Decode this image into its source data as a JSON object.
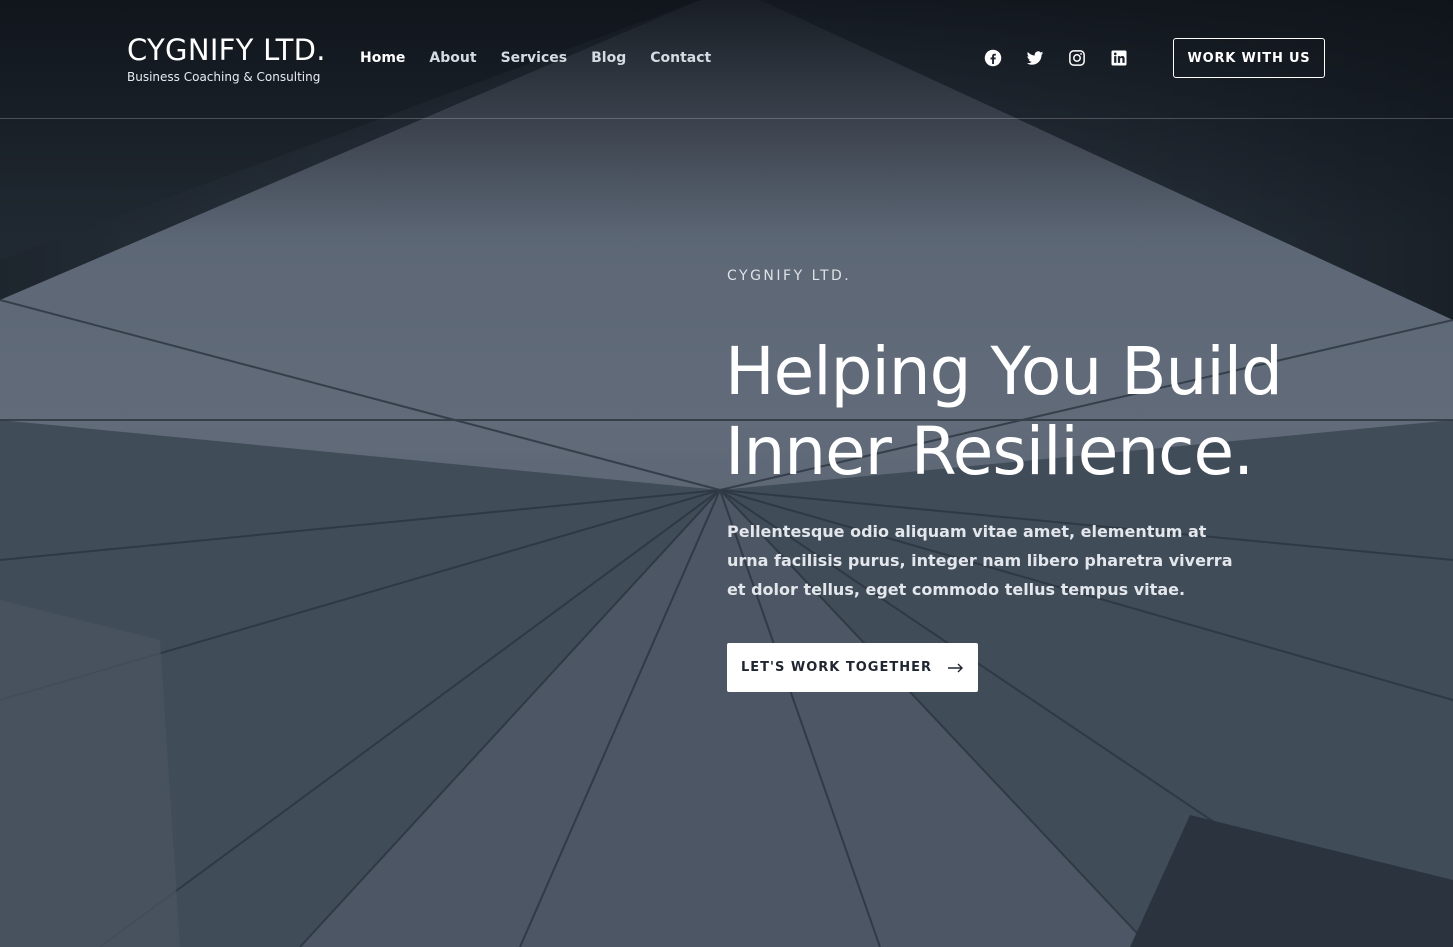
{
  "colors": {
    "overlay": "#2f3845",
    "text": "#ffffff",
    "button_bg": "#ffffff",
    "button_text": "#1f2630"
  },
  "header": {
    "brand_name": "CYGNIFY LTD.",
    "brand_tagline": "Business Coaching & Consulting",
    "nav": [
      {
        "label": "Home",
        "active": true
      },
      {
        "label": "About"
      },
      {
        "label": "Services"
      },
      {
        "label": "Blog"
      },
      {
        "label": "Contact"
      }
    ],
    "social_icons": [
      "facebook-icon",
      "twitter-icon",
      "instagram-icon",
      "linkedin-icon"
    ],
    "cta_label": "WORK WITH US"
  },
  "hero": {
    "eyebrow": "CYGNIFY LTD.",
    "headline_line1": "Helping You Build",
    "headline_line2": "Inner Resilience.",
    "description": "Pellentesque odio aliquam vitae amet, elementum at urna facilisis purus, integer nam libero pharetra viverra et dolor tellus, eget commodo tellus tempus vitae.",
    "cta_label": "LET'S WORK TOGETHER",
    "cta_icon": "arrow-right-icon",
    "background_image": "skyscraper-glass-facade-photo"
  }
}
